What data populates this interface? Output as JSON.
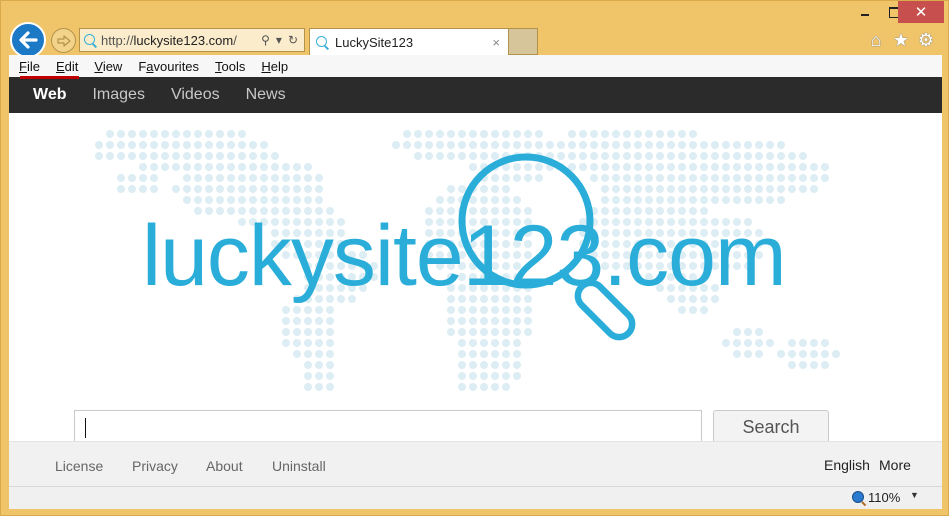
{
  "window": {
    "close_glyph": "✕",
    "icons": [
      "minimize-icon",
      "maximize-icon",
      "close-icon"
    ]
  },
  "nav_buttons": {
    "back_glyph": "🡐",
    "forward_glyph": "⇨"
  },
  "address_bar": {
    "scheme": "http://",
    "host": "luckysite123.com",
    "path": "/",
    "search_glyph": "⚲",
    "dropdown_glyph": "▾",
    "refresh_glyph": "↻"
  },
  "tab": {
    "title": "LuckySite123",
    "close_glyph": "×"
  },
  "toolbar_icons": {
    "home": "⌂",
    "favorites": "★",
    "settings": "⚙"
  },
  "menu": [
    {
      "label": "File",
      "key": "F",
      "rest": "ile"
    },
    {
      "label": "Edit",
      "key": "E",
      "rest": "dit"
    },
    {
      "label": "View",
      "key": "V",
      "rest": "iew"
    },
    {
      "label": "Favourites",
      "pre": "F",
      "key": "a",
      "rest": "vourites"
    },
    {
      "label": "Tools",
      "key": "T",
      "rest": "ools"
    },
    {
      "label": "Help",
      "key": "H",
      "rest": "elp"
    }
  ],
  "site_nav": [
    {
      "label": "Web",
      "active": true
    },
    {
      "label": "Images",
      "active": false
    },
    {
      "label": "Videos",
      "active": false
    },
    {
      "label": "News",
      "active": false
    }
  ],
  "logo": {
    "text": "luckysite123.com",
    "color": "#2aaed9"
  },
  "search": {
    "value": "",
    "button_label": "Search"
  },
  "footer": {
    "left_links": [
      "License",
      "Privacy",
      "About",
      "Uninstall"
    ],
    "right_links": [
      "English",
      "More"
    ]
  },
  "status_bar": {
    "zoom_level": "110%",
    "zoom_dropdown_glyph": "▼"
  },
  "colors": {
    "chrome": "#f0c56a",
    "close_button": "#c7504f",
    "back_button": "#1b79c6",
    "nav_bar": "#2b2b2b",
    "brand": "#2aaed9",
    "map_dots": "#dcedf3"
  }
}
